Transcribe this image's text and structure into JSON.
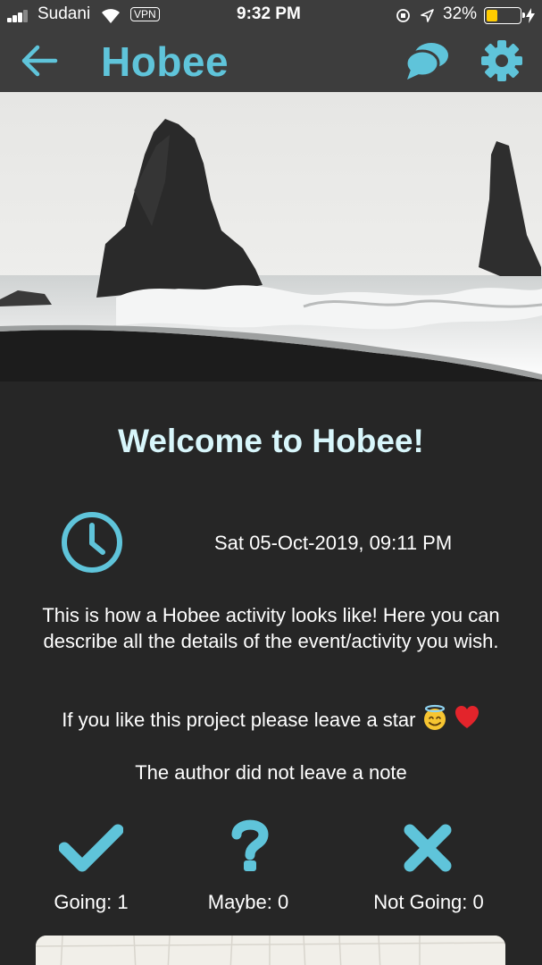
{
  "status_bar": {
    "carrier": "Sudani",
    "vpn": "VPN",
    "time": "9:32 PM",
    "battery": "32%",
    "battery_level": 0.32,
    "battery_color": "#ffcc00"
  },
  "app_bar": {
    "title": "Hobee",
    "accent_color": "#5fc4da",
    "back_icon": "arrow-left-icon",
    "chat_icon": "chat-bubbles-icon",
    "settings_icon": "gear-icon"
  },
  "event": {
    "heading": "Welcome to Hobee!",
    "datetime": "Sat 05-Oct-2019, 09:11 PM",
    "description": "This is how a Hobee activity looks like! Here you can describe all the details of the event/activity you wish.",
    "star_text": "If you like this project please leave a star",
    "note": "The author did not leave a note"
  },
  "rsvp": {
    "going": "Going: 1",
    "maybe": "Maybe: 0",
    "not_going": "Not Going: 0"
  }
}
